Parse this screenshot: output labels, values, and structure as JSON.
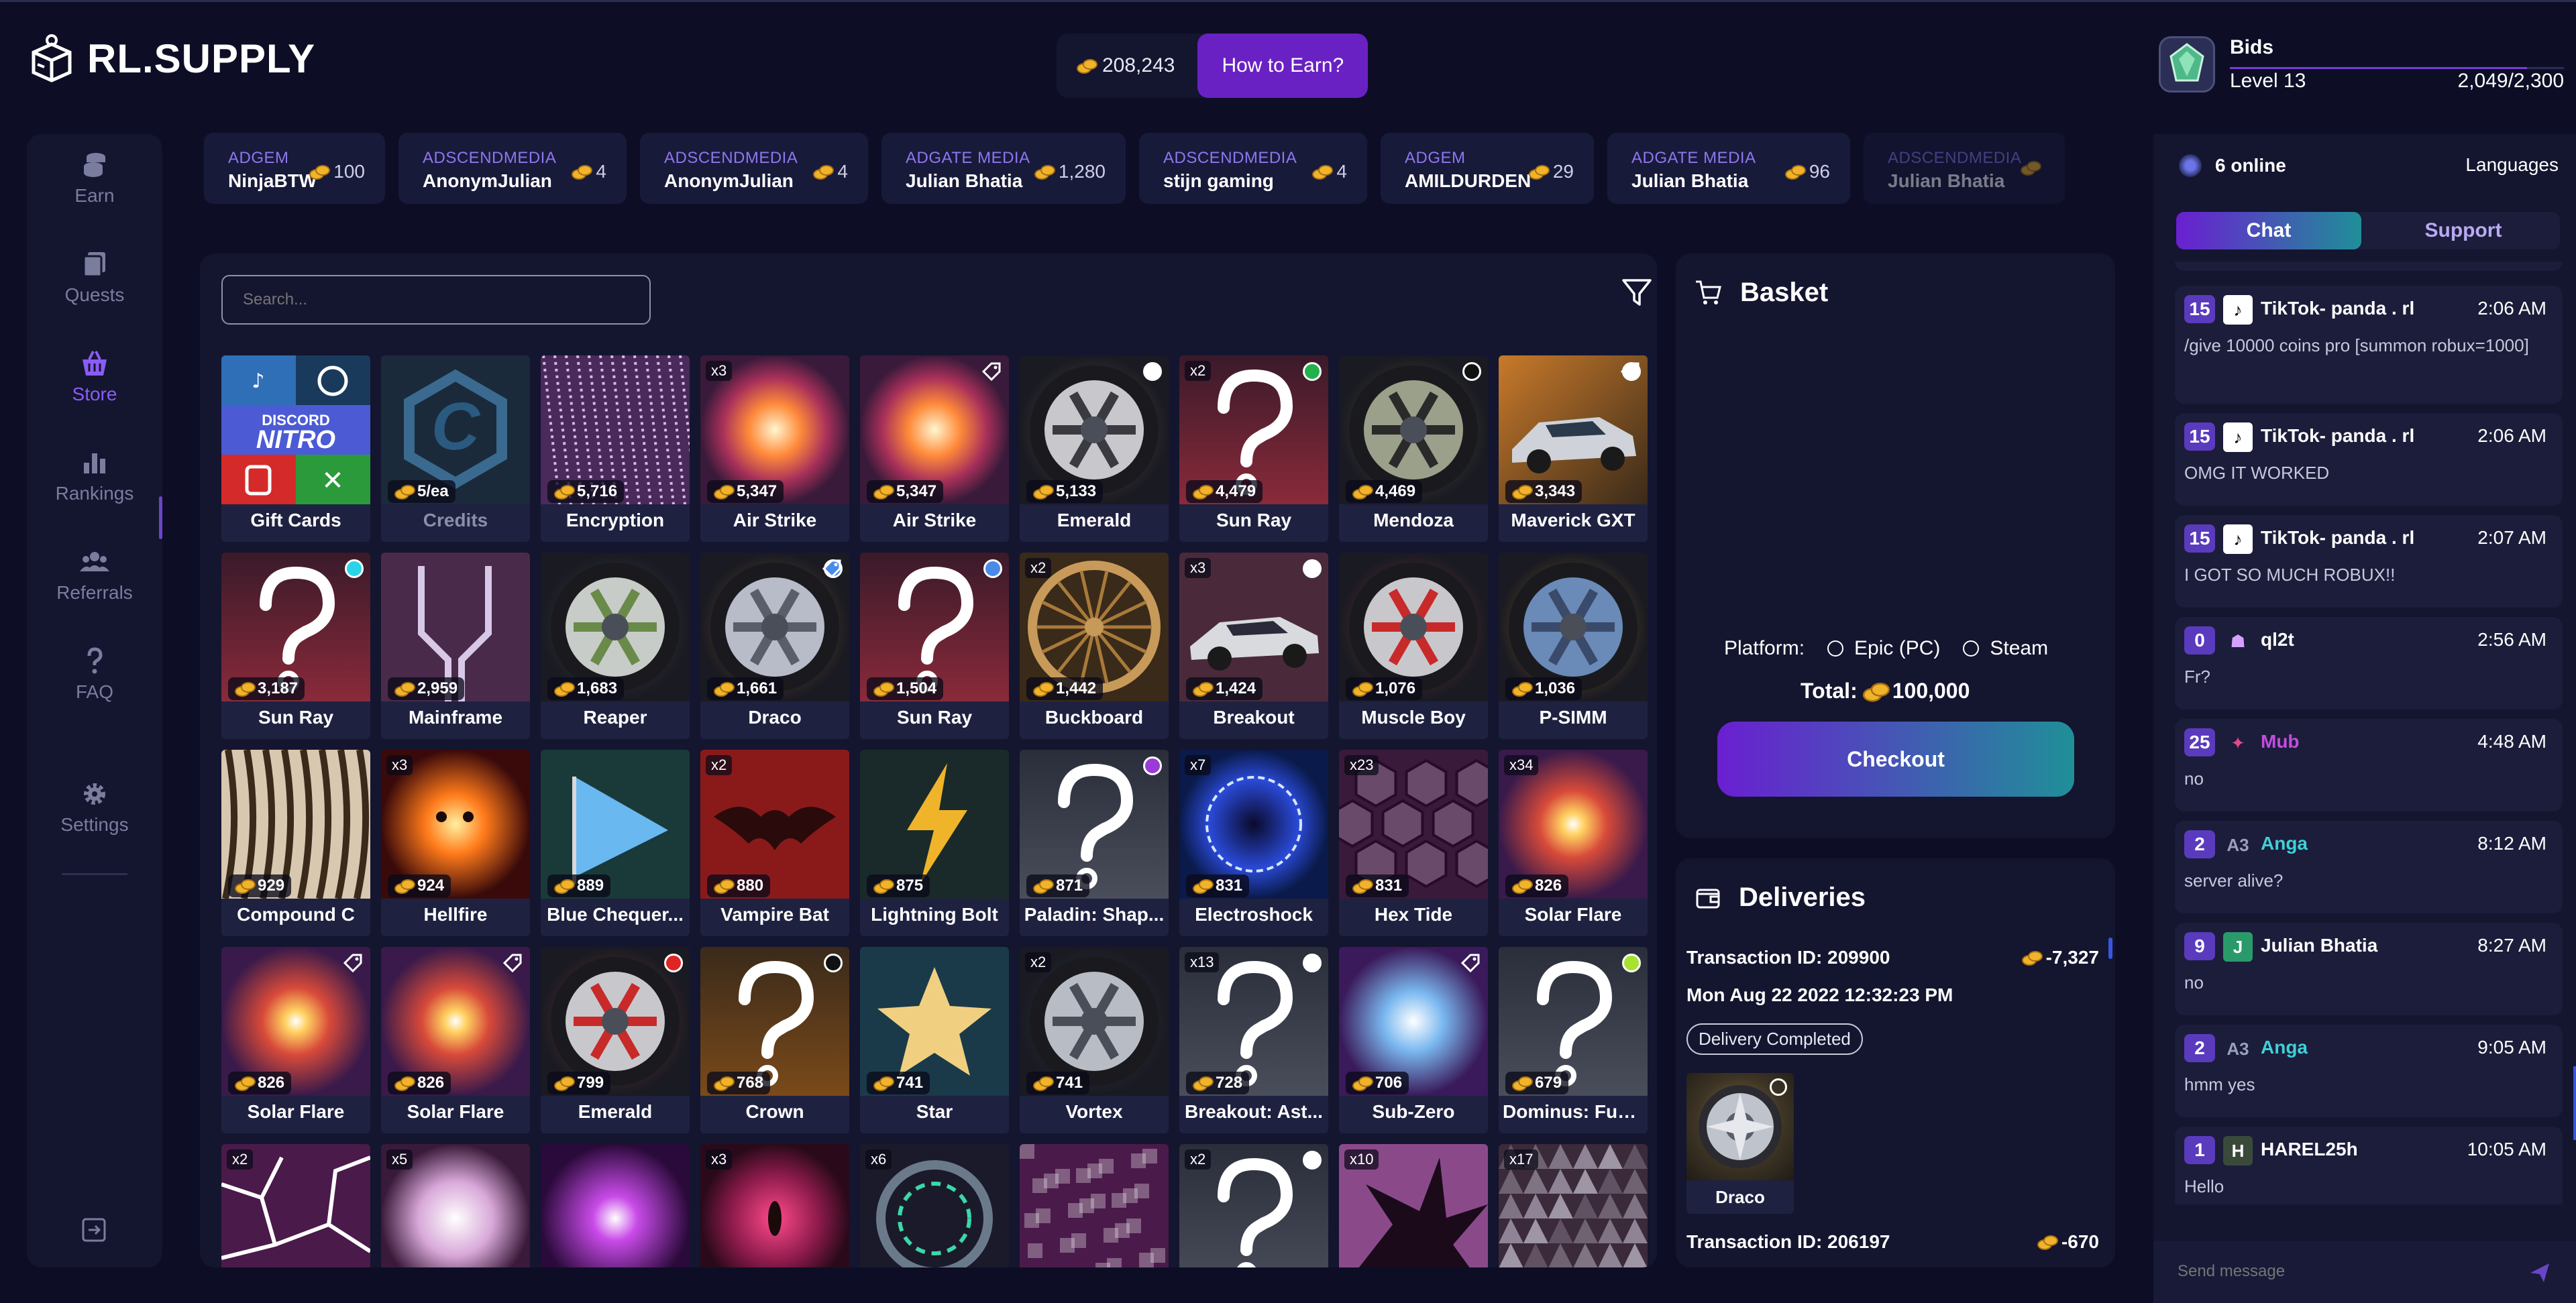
{
  "header": {
    "logo_text": "RL.SUPPLY",
    "balance": "208,243",
    "earn_button": "How to Earn?",
    "profile": {
      "name": "Bids",
      "level": "Level 13",
      "xp": "2,049/2,300",
      "xp_fraction": 0.89
    }
  },
  "nav": {
    "items": [
      {
        "label": "Earn",
        "icon": "coins-icon"
      },
      {
        "label": "Quests",
        "icon": "cards-icon"
      },
      {
        "label": "Store",
        "icon": "basket-icon"
      },
      {
        "label": "Rankings",
        "icon": "bar-chart-icon"
      },
      {
        "label": "Referrals",
        "icon": "users-icon"
      },
      {
        "label": "FAQ",
        "icon": "question-icon"
      },
      {
        "label": "Settings",
        "icon": "gear-icon"
      }
    ],
    "active": "Store"
  },
  "ticker": [
    {
      "source": "ADGEM",
      "user": "NinjaBTW",
      "amount": "100"
    },
    {
      "source": "ADSCENDMEDIA",
      "user": "AnonymJulian",
      "amount": "4"
    },
    {
      "source": "ADSCENDMEDIA",
      "user": "AnonymJulian",
      "amount": "4"
    },
    {
      "source": "ADGATE MEDIA",
      "user": "Julian Bhatia",
      "amount": "1,280"
    },
    {
      "source": "ADSCENDMEDIA",
      "user": "stijn gaming",
      "amount": "4"
    },
    {
      "source": "ADGEM",
      "user": "AMILDURDEN",
      "amount": "29"
    },
    {
      "source": "ADGATE MEDIA",
      "user": "Julian Bhatia",
      "amount": "96"
    },
    {
      "source": "ADSCENDMEDIA",
      "user": "Julian Bhatia",
      "amount": ""
    }
  ],
  "store": {
    "search_placeholder": "Search...",
    "items": [
      {
        "name": "Gift Cards",
        "price": "",
        "qty": "",
        "art": "giftcards",
        "dot": "",
        "tag": false,
        "dim": false
      },
      {
        "name": "Credits",
        "price": "5/ea",
        "qty": "",
        "art": "credits",
        "dot": "",
        "tag": false,
        "dim": true
      },
      {
        "name": "Encryption",
        "price": "5,716",
        "qty": "",
        "art": "encryption",
        "dot": "",
        "tag": false,
        "dim": false
      },
      {
        "name": "Air Strike",
        "price": "5,347",
        "qty": "x3",
        "art": "explosion",
        "dot": "",
        "tag": false,
        "dim": false
      },
      {
        "name": "Air Strike",
        "price": "5,347",
        "qty": "",
        "art": "explosion",
        "dot": "",
        "tag": true,
        "dim": false
      },
      {
        "name": "Emerald",
        "price": "5,133",
        "qty": "",
        "art": "wheel-silver",
        "dot": "#ffffff",
        "tag": false,
        "dim": false
      },
      {
        "name": "Sun Ray",
        "price": "4,479",
        "qty": "x2",
        "art": "mystery-red",
        "dot": "#22b14c",
        "tag": false,
        "dim": false
      },
      {
        "name": "Mendoza",
        "price": "4,469",
        "qty": "",
        "art": "wheel-green",
        "dot": "#111111",
        "tag": false,
        "dim": false
      },
      {
        "name": "Maverick GXT",
        "price": "3,343",
        "qty": "",
        "art": "car-orange",
        "dot": "#ffffff",
        "tag": true,
        "dim": false
      },
      {
        "name": "Sun Ray",
        "price": "3,187",
        "qty": "",
        "art": "mystery-red",
        "dot": "#2ad4e8",
        "tag": false,
        "dim": false
      },
      {
        "name": "Mainframe",
        "price": "2,959",
        "qty": "",
        "art": "mainframe",
        "dot": "",
        "tag": false,
        "dim": false
      },
      {
        "name": "Reaper",
        "price": "1,683",
        "qty": "",
        "art": "wheel-green2",
        "dot": "",
        "tag": false,
        "dim": false
      },
      {
        "name": "Draco",
        "price": "1,661",
        "qty": "",
        "art": "wheel-orange",
        "dot": "#4a8be8",
        "tag": true,
        "dim": false
      },
      {
        "name": "Sun Ray",
        "price": "1,504",
        "qty": "",
        "art": "mystery-red",
        "dot": "#4a8be8",
        "tag": false,
        "dim": false
      },
      {
        "name": "Buckboard",
        "price": "1,442",
        "qty": "x2",
        "art": "wheel-wood",
        "dot": "",
        "tag": false,
        "dim": false
      },
      {
        "name": "Breakout",
        "price": "1,424",
        "qty": "x3",
        "art": "car-dark",
        "dot": "#ffffff",
        "tag": false,
        "dim": false
      },
      {
        "name": "Muscle Boy",
        "price": "1,076",
        "qty": "",
        "art": "wheel-red",
        "dot": "",
        "tag": false,
        "dim": false
      },
      {
        "name": "P-SIMM",
        "price": "1,036",
        "qty": "",
        "art": "wheel-orange2",
        "dot": "",
        "tag": false,
        "dim": false
      },
      {
        "name": "Compound C",
        "price": "929",
        "qty": "",
        "art": "compound",
        "dot": "",
        "tag": false,
        "dim": false
      },
      {
        "name": "Hellfire",
        "price": "924",
        "qty": "x3",
        "art": "hellfire",
        "dot": "",
        "tag": false,
        "dim": false
      },
      {
        "name": "Blue Chequer...",
        "price": "889",
        "qty": "",
        "art": "flag",
        "dot": "",
        "tag": false,
        "dim": false
      },
      {
        "name": "Vampire Bat",
        "price": "880",
        "qty": "x2",
        "art": "bat",
        "dot": "",
        "tag": false,
        "dim": false
      },
      {
        "name": "Lightning Bolt",
        "price": "875",
        "qty": "",
        "art": "bolt",
        "dot": "",
        "tag": false,
        "dim": false
      },
      {
        "name": "Paladin: Shap...",
        "price": "871",
        "qty": "",
        "art": "mystery-grey",
        "dot": "#9b3bd6",
        "tag": false,
        "dim": false
      },
      {
        "name": "Electroshock",
        "price": "831",
        "qty": "x7",
        "art": "electro",
        "dot": "",
        "tag": false,
        "dim": false
      },
      {
        "name": "Hex Tide",
        "price": "831",
        "qty": "x23",
        "art": "hex",
        "dot": "",
        "tag": false,
        "dim": false
      },
      {
        "name": "Solar Flare",
        "price": "826",
        "qty": "x34",
        "art": "flare",
        "dot": "",
        "tag": false,
        "dim": false
      },
      {
        "name": "Solar Flare",
        "price": "826",
        "qty": "",
        "art": "flare",
        "dot": "",
        "tag": true,
        "dim": false
      },
      {
        "name": "Solar Flare",
        "price": "826",
        "qty": "",
        "art": "flare",
        "dot": "",
        "tag": true,
        "dim": false
      },
      {
        "name": "Emerald",
        "price": "799",
        "qty": "",
        "art": "wheel-red",
        "dot": "#e02424",
        "tag": false,
        "dim": false
      },
      {
        "name": "Crown",
        "price": "768",
        "qty": "",
        "art": "mystery-orange",
        "dot": "#111111",
        "tag": false,
        "dim": false
      },
      {
        "name": "Star",
        "price": "741",
        "qty": "",
        "art": "star",
        "dot": "",
        "tag": false,
        "dim": false
      },
      {
        "name": "Vortex",
        "price": "741",
        "qty": "x2",
        "art": "wheel-silver2",
        "dot": "",
        "tag": false,
        "dim": false
      },
      {
        "name": "Breakout: Ast...",
        "price": "728",
        "qty": "x13",
        "art": "mystery-grey",
        "dot": "#ffffff",
        "tag": false,
        "dim": false
      },
      {
        "name": "Sub-Zero",
        "price": "706",
        "qty": "",
        "art": "subzero",
        "dot": "",
        "tag": true,
        "dim": false
      },
      {
        "name": "Dominus: Fun...",
        "price": "679",
        "qty": "",
        "art": "mystery-grey",
        "dot": "#a6e22e",
        "tag": false,
        "dim": false
      },
      {
        "name": "",
        "price": "",
        "qty": "x2",
        "art": "cracks",
        "dot": "",
        "tag": false,
        "dim": false
      },
      {
        "name": "",
        "price": "",
        "qty": "x5",
        "art": "sphere",
        "dot": "",
        "tag": false,
        "dim": false
      },
      {
        "name": "",
        "price": "",
        "qty": "",
        "art": "purpleburst",
        "dot": "",
        "tag": false,
        "dim": false
      },
      {
        "name": "",
        "price": "",
        "qty": "x3",
        "art": "eye",
        "dot": "",
        "tag": false,
        "dim": false
      },
      {
        "name": "",
        "price": "",
        "qty": "x6",
        "art": "portal",
        "dot": "",
        "tag": false,
        "dim": false
      },
      {
        "name": "",
        "price": "",
        "qty": "",
        "art": "pixels",
        "dot": "",
        "tag": false,
        "dim": false
      },
      {
        "name": "",
        "price": "",
        "qty": "x2",
        "art": "mystery-grey",
        "dot": "#ffffff",
        "tag": false,
        "dim": false
      },
      {
        "name": "",
        "price": "",
        "qty": "x10",
        "art": "splash",
        "dot": "",
        "tag": false,
        "dim": false
      },
      {
        "name": "",
        "price": "",
        "qty": "x17",
        "art": "tiles",
        "dot": "",
        "tag": false,
        "dim": false
      }
    ]
  },
  "basket": {
    "title": "Basket",
    "platform_label": "Platform:",
    "platform_options": [
      "Epic (PC)",
      "Steam"
    ],
    "total_label": "Total:",
    "total_value": "100,000",
    "checkout": "Checkout"
  },
  "deliveries": {
    "title": "Deliveries",
    "tx1_id": "Transaction ID: 209900",
    "tx1_amount": "-7,327",
    "tx1_date": "Mon Aug 22 2022 12:32:23 PM",
    "tx1_status": "Delivery Completed",
    "tx1_item": "Draco",
    "tx2_id": "Transaction ID: 206197",
    "tx2_amount": "-670"
  },
  "chat": {
    "online": "6 online",
    "languages": "Languages",
    "tab_chat": "Chat",
    "tab_support": "Support",
    "messages": [
      {
        "level": "15",
        "user": "TikTok- panda . rl",
        "time": "2:06 AM",
        "text": "/give 10000 coins pro [summon robux=1000]",
        "color": "#ffffff",
        "av": "tiktok"
      },
      {
        "level": "15",
        "user": "TikTok- panda . rl",
        "time": "2:06 AM",
        "text": "OMG IT WORKED",
        "color": "#ffffff",
        "av": "tiktok"
      },
      {
        "level": "15",
        "user": "TikTok- panda . rl",
        "time": "2:07 AM",
        "text": "I GOT SO MUCH ROBUX!!",
        "color": "#ffffff",
        "av": "tiktok"
      },
      {
        "level": "0",
        "user": "ql2t",
        "time": "2:56 AM",
        "text": "Fr?",
        "color": "#ffffff",
        "av": "ql2t"
      },
      {
        "level": "25",
        "user": "Mub",
        "time": "4:48 AM",
        "text": "no",
        "color": "#c44de0",
        "av": "mub"
      },
      {
        "level": "2",
        "user": "Anga",
        "time": "8:12 AM",
        "text": "server alive?",
        "color": "#3fd0d8",
        "av": "anga"
      },
      {
        "level": "9",
        "user": "Julian Bhatia",
        "time": "8:27 AM",
        "text": "no",
        "color": "#ffffff",
        "av": "J"
      },
      {
        "level": "2",
        "user": "Anga",
        "time": "9:05 AM",
        "text": "hmm yes",
        "color": "#3fd0d8",
        "av": "anga"
      },
      {
        "level": "1",
        "user": "HAREL25h",
        "time": "10:05 AM",
        "text": "Hello",
        "color": "#ffffff",
        "av": "H"
      }
    ],
    "send_placeholder": "Send message"
  },
  "colors": {
    "bg": "#0d0e26",
    "panel": "#14152f",
    "accent": "#6a21c4",
    "teal": "#1f8f98",
    "coin": "#f0b42a"
  }
}
